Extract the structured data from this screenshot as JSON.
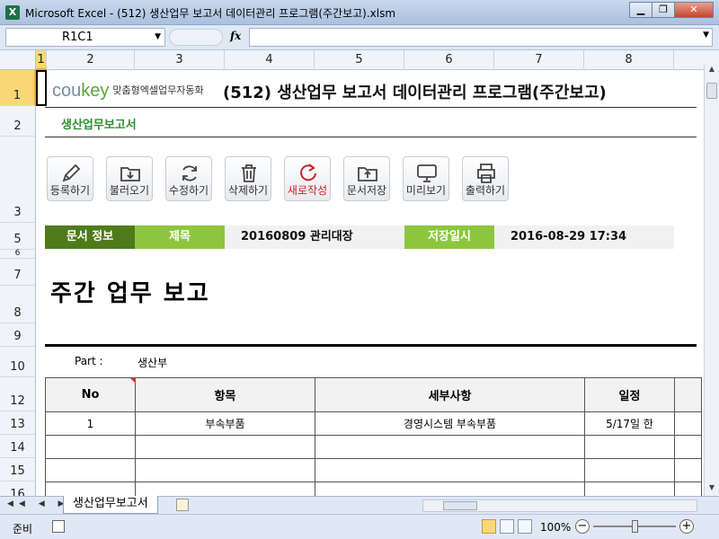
{
  "window": {
    "app_icon": "X",
    "title": "Microsoft Excel - (512) 생산업무 보고서 데이터관리 프로그램(주간보고).xlsm",
    "buttons": [
      "▁",
      "❐",
      "✕"
    ]
  },
  "formula_bar": {
    "name_box": "R1C1",
    "fx": "fx",
    "formula": ""
  },
  "columns": [
    "1",
    "2",
    "3",
    "4",
    "5",
    "6",
    "7",
    "8"
  ],
  "rows": [
    "1",
    "2",
    "3",
    "5",
    "6",
    "7",
    "8",
    "9",
    "10",
    "12",
    "13",
    "14",
    "15",
    "16"
  ],
  "header": {
    "logo_cou": "cou",
    "logo_key": "key",
    "logo_tag": "맞춤형엑셀업무자동화",
    "title": "(512) 생산업무 보고서 데이터관리 프로그램(주간보고)",
    "subtitle": "생산업무보고서"
  },
  "toolbar": [
    {
      "label": "등록하기",
      "icon": "pencil-icon"
    },
    {
      "label": "불러오기",
      "icon": "folder-download-icon"
    },
    {
      "label": "수정하기",
      "icon": "refresh-icon"
    },
    {
      "label": "삭제하기",
      "icon": "trash-icon"
    },
    {
      "label": "새로작성",
      "icon": "new-refresh-icon"
    },
    {
      "label": "문서저장",
      "icon": "folder-upload-icon"
    },
    {
      "label": "미리보기",
      "icon": "monitor-icon"
    },
    {
      "label": "출력하기",
      "icon": "printer-icon"
    }
  ],
  "info_bar": {
    "doc_info_label": "문서 정보",
    "title_label": "제목",
    "title_value": "20160809 관리대장",
    "saved_label": "저장일시",
    "saved_value": "2016-08-29 17:34"
  },
  "report": {
    "heading": "주간 업무 보고",
    "part_label": "Part :",
    "part_value": "생산부",
    "table_headers": [
      "No",
      "항목",
      "세부사항",
      "일정"
    ],
    "table_rows": [
      [
        "1",
        "부속부품",
        "경영시스템 부속부품",
        "5/17일 한"
      ],
      [
        "",
        "",
        "",
        ""
      ],
      [
        "",
        "",
        "",
        ""
      ],
      [
        "",
        "",
        "",
        ""
      ]
    ]
  },
  "sheet_tabs": {
    "active": "생산업무보고서",
    "nav": "◀◀ ◀ ▶ ▶▶"
  },
  "status_bar": {
    "status": "준비",
    "zoom": "100%",
    "zoom_minus": "−",
    "zoom_plus": "+"
  },
  "colors": {
    "brand_green": "#5aa637",
    "info_dark": "#4f7a19",
    "info_light": "#8cc63f",
    "new_button_text": "#c62828"
  }
}
